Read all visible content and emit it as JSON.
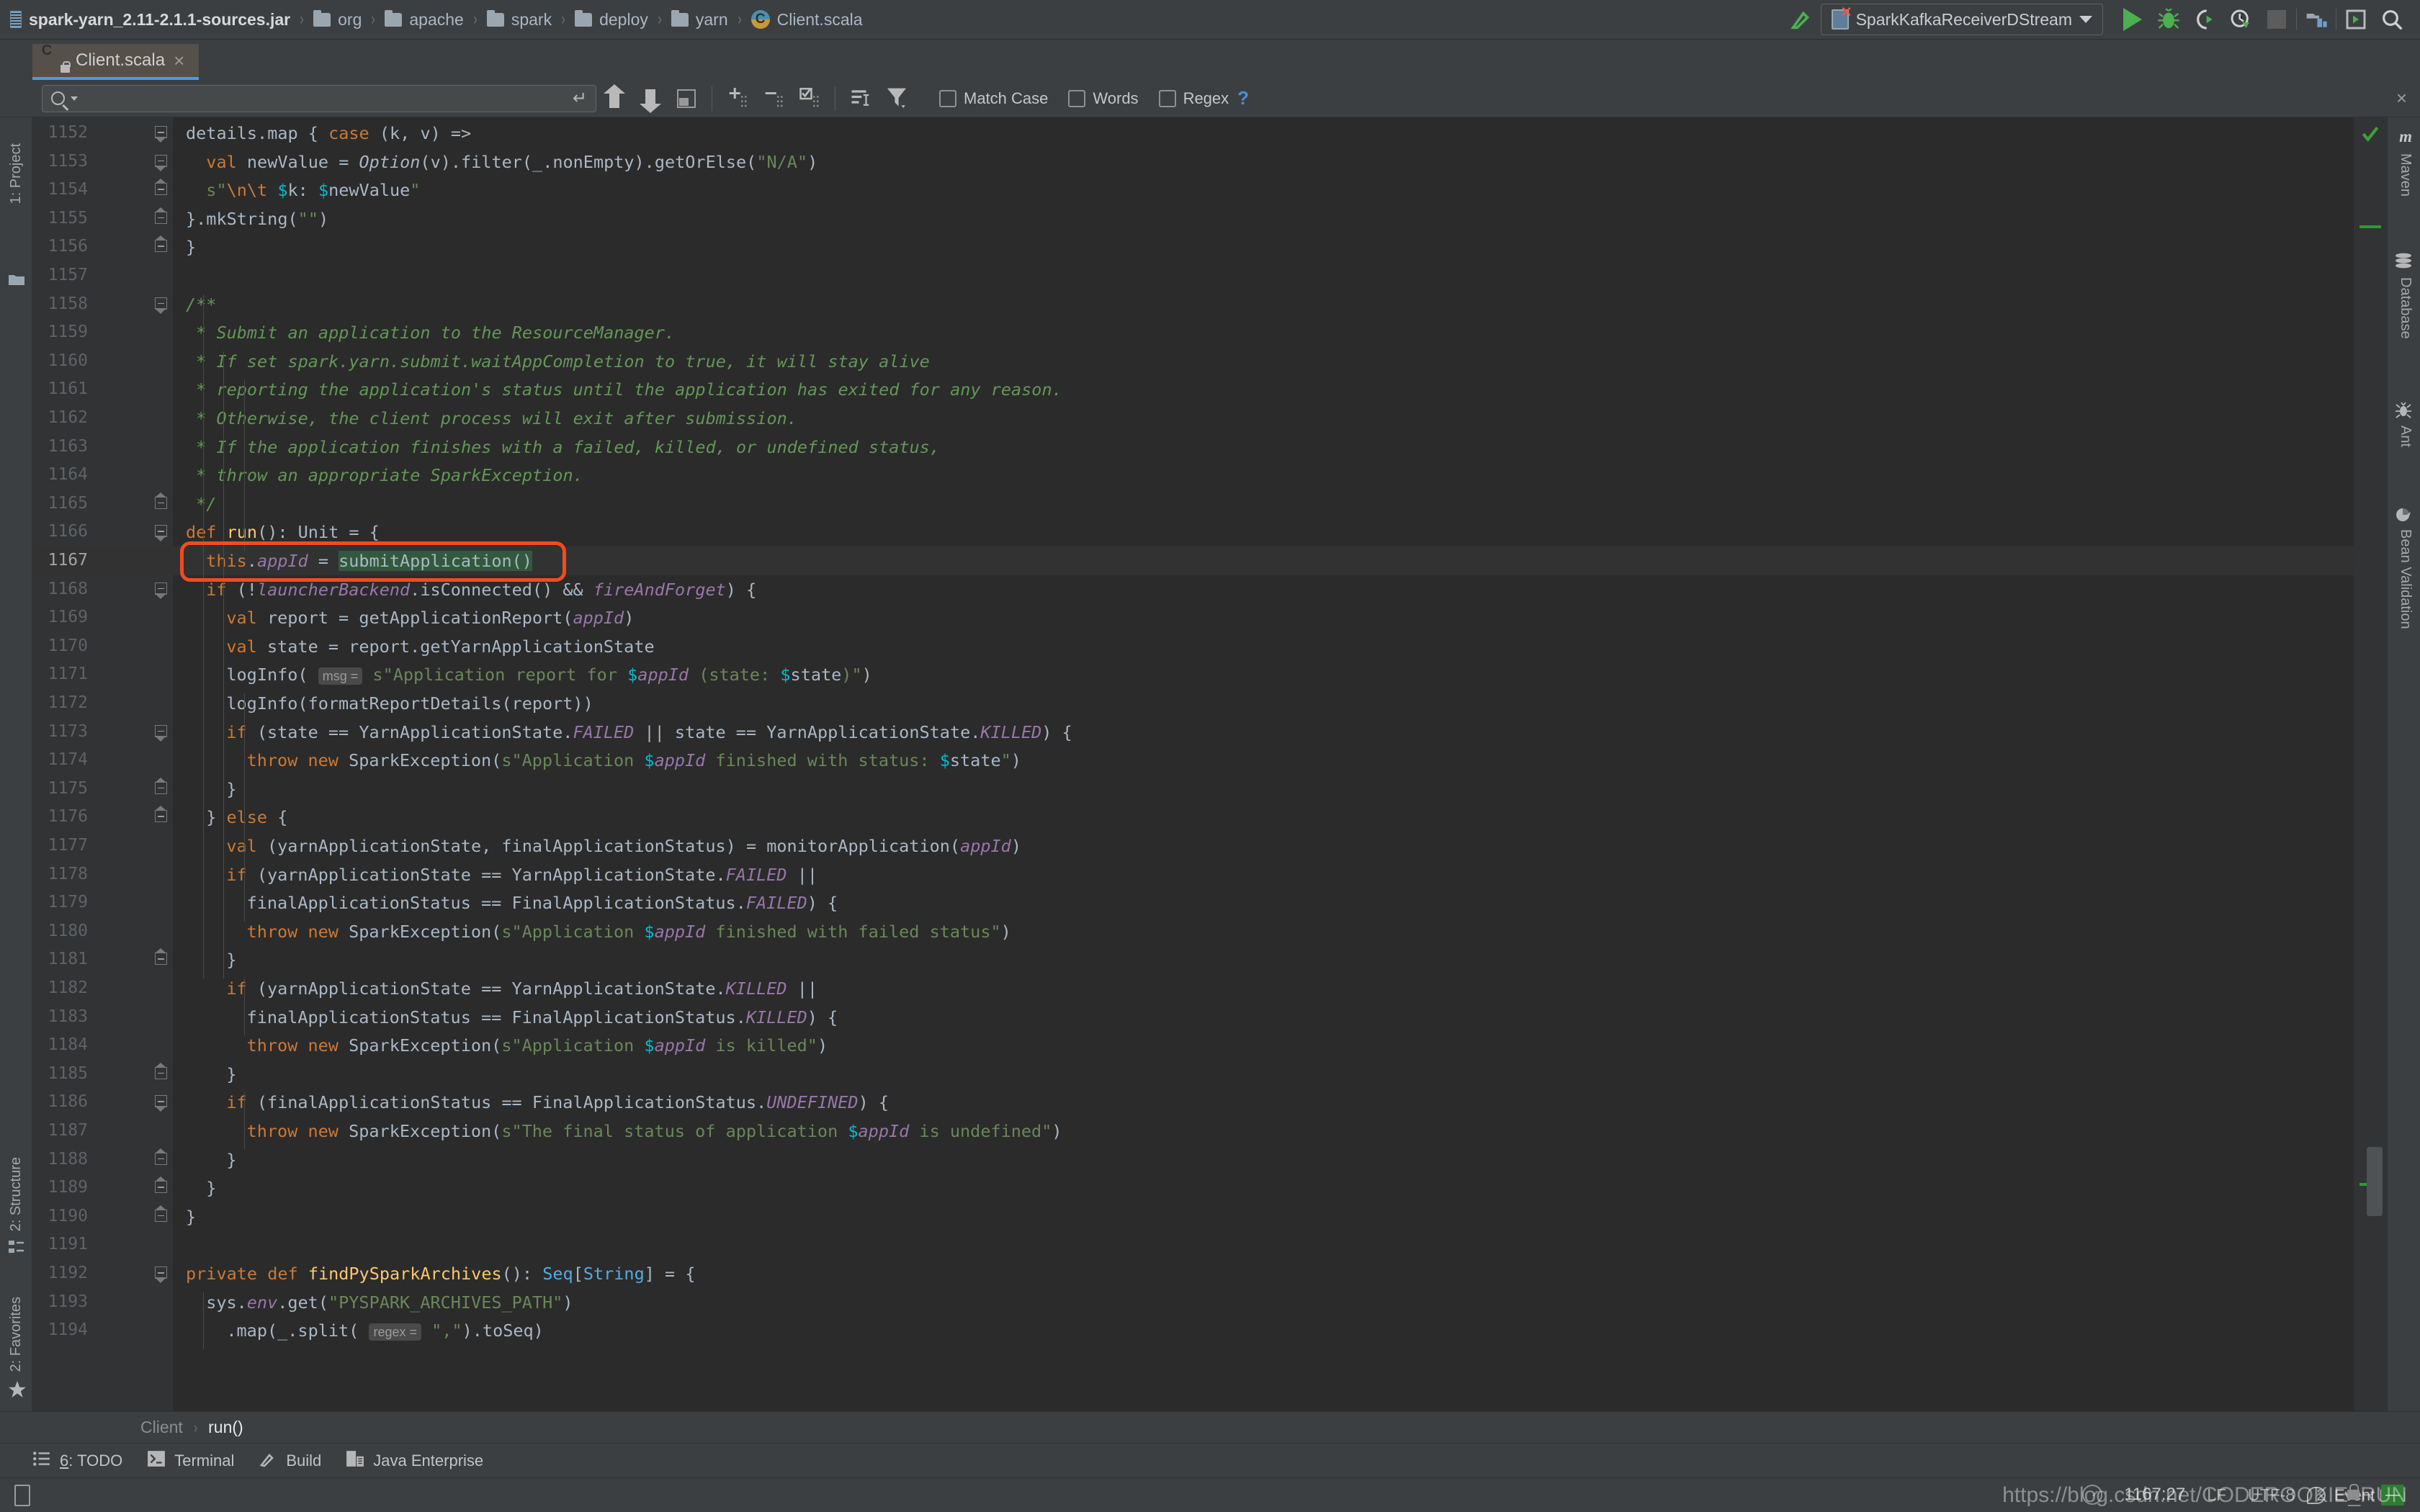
{
  "window": {
    "breadcrumbs": [
      {
        "label": "spark-yarn_2.11-2.1.1-sources.jar",
        "icon": "jar-icon"
      },
      {
        "label": "org",
        "icon": "folder-icon"
      },
      {
        "label": "apache",
        "icon": "folder-icon"
      },
      {
        "label": "spark",
        "icon": "folder-icon"
      },
      {
        "label": "deploy",
        "icon": "folder-icon"
      },
      {
        "label": "yarn",
        "icon": "folder-icon"
      },
      {
        "label": "Client.scala",
        "icon": "scala-file-icon"
      }
    ],
    "run_configuration": "SparkKafkaReceiverDStream",
    "toolbar_buttons": [
      "run-button",
      "debug-button",
      "run-coverage-button",
      "profile-button",
      "stop-button",
      "build-project-button",
      "run-anything-button",
      "search-everywhere-button"
    ]
  },
  "tabs": [
    {
      "label": "Client.scala",
      "icon": "scala-file-locked-icon",
      "active": true,
      "close": "×"
    }
  ],
  "findbar": {
    "value": "",
    "placeholder": "",
    "match_case_label": "Match Case",
    "words_label": "Words",
    "regex_label": "Regex",
    "help_label": "?",
    "close_label": "×",
    "buttons": [
      "find-previous-icon",
      "find-next-icon",
      "select-all-occurrences-icon",
      "add-line-icon",
      "remove-line-icon",
      "toggle-line-icon",
      "filter-results-icon",
      "filter-icon"
    ]
  },
  "sidebars": {
    "left": [
      {
        "label": "1: Project",
        "icon": "project-folder-icon"
      },
      {
        "label": "2: Structure",
        "icon": "structure-icon"
      },
      {
        "label": "2: Favorites",
        "icon": "star-icon"
      }
    ],
    "right": [
      {
        "label": "Maven",
        "icon": "maven-icon"
      },
      {
        "label": "Database",
        "icon": "database-icon"
      },
      {
        "label": "Ant",
        "icon": "ant-icon"
      },
      {
        "label": "Bean Validation",
        "icon": "bean-validation-icon"
      }
    ]
  },
  "editor": {
    "first_line": 1152,
    "current_line": 1167,
    "lines": [
      {
        "n": 1152,
        "fold": "open",
        "indent": 0,
        "html": "<span class=\"scope\">details</span>.<span class=\"scope\">map</span> { <span class=\"kw\">case</span> (k, v) =&gt;"
      },
      {
        "n": 1153,
        "fold": "open",
        "indent": 0,
        "html": "  <span class=\"kw\">val</span> newValue = <span class=\"cmt\" style=\"color:#a9b7c6\">Option</span>(v).filter(_.nonEmpty).getOrElse(<span class=\"str\">\"N/A\"</span>)"
      },
      {
        "n": 1154,
        "fold": "closeb",
        "indent": 0,
        "html": "  <span class=\"str\">s\"</span><span class=\"esc\">\\n\\t</span> <span class=\"tmpl\">$</span>k: <span class=\"tmpl\">$</span>newValue<span class=\"str\">\"</span>"
      },
      {
        "n": 1155,
        "fold": "closeb",
        "indent": 0,
        "html": "}.mkString(<span class=\"str\">\"\"</span>)"
      },
      {
        "n": 1156,
        "fold": "closeb",
        "indent": 0,
        "html": "}"
      },
      {
        "n": 1157,
        "fold": "",
        "indent": 0,
        "html": ""
      },
      {
        "n": 1158,
        "fold": "open",
        "indent": 0,
        "html": "<span class=\"cmt\">/**</span>"
      },
      {
        "n": 1159,
        "fold": "",
        "indent": 0,
        "html": " <span class=\"cmt\">* Submit an application to the ResourceManager.</span>"
      },
      {
        "n": 1160,
        "fold": "",
        "indent": 0,
        "html": " <span class=\"cmt\">* If set spark.yarn.submit.waitAppCompletion to true, it will stay alive</span>"
      },
      {
        "n": 1161,
        "fold": "",
        "indent": 0,
        "html": " <span class=\"cmt\">* reporting the application's status until the application has exited for any reason.</span>"
      },
      {
        "n": 1162,
        "fold": "",
        "indent": 0,
        "html": " <span class=\"cmt\">* Otherwise, the client process will exit after submission.</span>"
      },
      {
        "n": 1163,
        "fold": "",
        "indent": 0,
        "html": " <span class=\"cmt\">* If the application finishes with a failed, killed, or undefined status,</span>"
      },
      {
        "n": 1164,
        "fold": "",
        "indent": 0,
        "html": " <span class=\"cmt\">* throw an appropriate SparkException.</span>"
      },
      {
        "n": 1165,
        "fold": "closeb",
        "indent": 0,
        "html": " <span class=\"cmt\">*/</span>"
      },
      {
        "n": 1166,
        "fold": "open",
        "indent": 0,
        "html": "<span class=\"kw\">def</span> <span class=\"mth\">run</span>(): <span class=\"typ\">Unit</span> = {"
      },
      {
        "n": 1167,
        "fold": "",
        "indent": 1,
        "html": "<span class=\"kw\">this</span>.<span class=\"fld\">appId</span> = <span class=\"greenhl\">submitApplication()</span>"
      },
      {
        "n": 1168,
        "fold": "open",
        "indent": 1,
        "html": "<span class=\"kw\">if</span> (!<span class=\"fld\">launcherBackend</span>.isConnected() &amp;&amp; <span class=\"fld\">fireAndForget</span>) {"
      },
      {
        "n": 1169,
        "fold": "",
        "indent": 2,
        "html": "<span class=\"kw\">val</span> report = getApplicationReport(<span class=\"fld\">appId</span>)"
      },
      {
        "n": 1170,
        "fold": "",
        "indent": 2,
        "html": "<span class=\"kw\">val</span> state = report.getYarnApplicationState"
      },
      {
        "n": 1171,
        "fold": "",
        "indent": 2,
        "html": "logInfo( <span class=\"hintbadge\">msg =</span> <span class=\"str\">s\"Application report for </span><span class=\"tmpl\">$</span><span class=\"fld\">appId</span><span class=\"str\"> (state: </span><span class=\"tmpl\">$</span>state<span class=\"str\">)\"</span>)"
      },
      {
        "n": 1172,
        "fold": "",
        "indent": 2,
        "html": "logInfo(formatReportDetails(report))"
      },
      {
        "n": 1173,
        "fold": "open",
        "indent": 2,
        "html": "<span class=\"kw\">if</span> (state == YarnApplicationState.<span class=\"stc\">FAILED</span> || state == YarnApplicationState.<span class=\"stc\">KILLED</span>) {"
      },
      {
        "n": 1174,
        "fold": "",
        "indent": 3,
        "html": "<span class=\"kw\">throw</span> <span class=\"kw\">new</span> SparkException(<span class=\"str\">s\"Application </span><span class=\"tmpl\">$</span><span class=\"fld\">appId</span><span class=\"str\"> finished with status: </span><span class=\"tmpl\">$</span>state<span class=\"str\">\"</span>)"
      },
      {
        "n": 1175,
        "fold": "closeb",
        "indent": 2,
        "html": "}"
      },
      {
        "n": 1176,
        "fold": "closeb",
        "indent": 1,
        "html": "} <span class=\"kw\">else</span> {"
      },
      {
        "n": 1177,
        "fold": "",
        "indent": 2,
        "html": "<span class=\"kw\">val</span> (yarnApplicationState, finalApplicationStatus) = monitorApplication(<span class=\"fld\">appId</span>)"
      },
      {
        "n": 1178,
        "fold": "",
        "indent": 2,
        "html": "<span class=\"kw\">if</span> (yarnApplicationState == YarnApplicationState.<span class=\"stc\">FAILED</span> ||"
      },
      {
        "n": 1179,
        "fold": "",
        "indent": 3,
        "html": "finalApplicationStatus == FinalApplicationStatus.<span class=\"stc\">FAILED</span>) {"
      },
      {
        "n": 1180,
        "fold": "",
        "indent": 3,
        "html": "<span class=\"kw\">throw</span> <span class=\"kw\">new</span> SparkException(<span class=\"str\">s\"Application </span><span class=\"tmpl\">$</span><span class=\"fld\">appId</span><span class=\"str\"> finished with failed status\"</span>)"
      },
      {
        "n": 1181,
        "fold": "closeb",
        "indent": 2,
        "html": "}"
      },
      {
        "n": 1182,
        "fold": "",
        "indent": 2,
        "html": "<span class=\"kw\">if</span> (yarnApplicationState == YarnApplicationState.<span class=\"stc\">KILLED</span> ||"
      },
      {
        "n": 1183,
        "fold": "",
        "indent": 3,
        "html": "finalApplicationStatus == FinalApplicationStatus.<span class=\"stc\">KILLED</span>) {"
      },
      {
        "n": 1184,
        "fold": "",
        "indent": 3,
        "html": "<span class=\"kw\">throw</span> <span class=\"kw\">new</span> SparkException(<span class=\"str\">s\"Application </span><span class=\"tmpl\">$</span><span class=\"fld\">appId</span><span class=\"str\"> is killed\"</span>)"
      },
      {
        "n": 1185,
        "fold": "closeb",
        "indent": 2,
        "html": "}"
      },
      {
        "n": 1186,
        "fold": "open",
        "indent": 2,
        "html": "<span class=\"kw\">if</span> (finalApplicationStatus == FinalApplicationStatus.<span class=\"stc\">UNDEFINED</span>) {"
      },
      {
        "n": 1187,
        "fold": "",
        "indent": 3,
        "html": "<span class=\"kw\">throw</span> <span class=\"kw\">new</span> SparkException(<span class=\"str\">s\"The final status of application </span><span class=\"tmpl\">$</span><span class=\"fld\">appId</span><span class=\"str\"> is undefined\"</span>)"
      },
      {
        "n": 1188,
        "fold": "closeb",
        "indent": 2,
        "html": "}"
      },
      {
        "n": 1189,
        "fold": "closeb",
        "indent": 1,
        "html": "}"
      },
      {
        "n": 1190,
        "fold": "closeb",
        "indent": 0,
        "html": "}"
      },
      {
        "n": 1191,
        "fold": "",
        "indent": 0,
        "html": ""
      },
      {
        "n": 1192,
        "fold": "open",
        "indent": 0,
        "html": "<span class=\"kw\">private</span> <span class=\"kw\">def</span> <span class=\"mth\">findPySparkArchives</span>(): <span class=\"trait\">Seq</span>[<span class=\"trait\">String</span>] = {"
      },
      {
        "n": 1193,
        "fold": "",
        "indent": 1,
        "html": "sys.<span class=\"fld\">env</span>.get(<span class=\"str\">\"PYSPARK_ARCHIVES_PATH\"</span>)"
      },
      {
        "n": 1194,
        "fold": "",
        "indent": 2,
        "html": ".map(_.split( <span class=\"hintbadge\">regex =</span> <span class=\"str\">\",\"</span>).toSeq)"
      }
    ]
  },
  "editor_breadcrumb": [
    {
      "label": "Client"
    },
    {
      "label": "run()"
    }
  ],
  "toolwindows": [
    {
      "num": "6",
      "label": ": TODO",
      "icon": "todo-list-icon"
    },
    {
      "num": "",
      "label": "Terminal",
      "icon": "terminal-icon"
    },
    {
      "num": "",
      "label": "Build",
      "icon": "build-hammer-icon"
    },
    {
      "num": "",
      "label": "Java Enterprise",
      "icon": "java-enterprise-icon"
    }
  ],
  "status": {
    "event_log": "Event Log",
    "caret_position": "1167:27",
    "line_separator": "LF",
    "encoding": "UTF-8",
    "indent": "2",
    "lock_icon": "lock-icon",
    "watermark": "https://blog.csdn.net/CODEROOKIE_RUN"
  },
  "colors": {
    "background": "#2b2b2b",
    "panel": "#3c3f41",
    "gutter": "#313335",
    "accent": "#4e9ae0",
    "annotation_red": "#f24a22",
    "keyword_orange": "#cc7832",
    "string_green": "#6a8759",
    "comment_green": "#629755",
    "field_purple": "#9876aa",
    "method_yellow": "#ffc66d",
    "run_green": "#4caf50"
  }
}
